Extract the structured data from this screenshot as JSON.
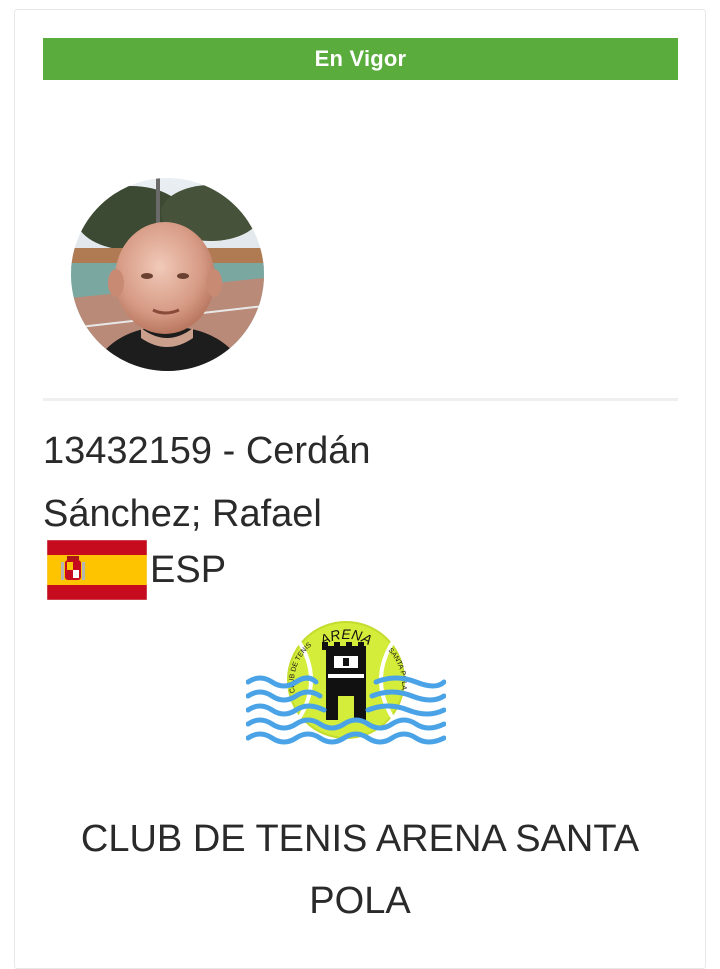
{
  "status": {
    "label": "En Vigor",
    "color": "#5aac3c"
  },
  "member": {
    "name_line": "13432159 - Cerdán Sánchez; Rafael",
    "photo": "member-photo"
  },
  "nationality": {
    "flag_icon": "spain-flag-icon",
    "code": "ESP"
  },
  "club": {
    "logo_icon": "arena-santa-pola-logo-icon",
    "logo_text_top": "ARENA",
    "logo_text_left": "CLUB DE TENIS",
    "logo_text_right": "SANTA POLA",
    "name": "CLUB DE TENIS ARENA SANTA POLA"
  }
}
